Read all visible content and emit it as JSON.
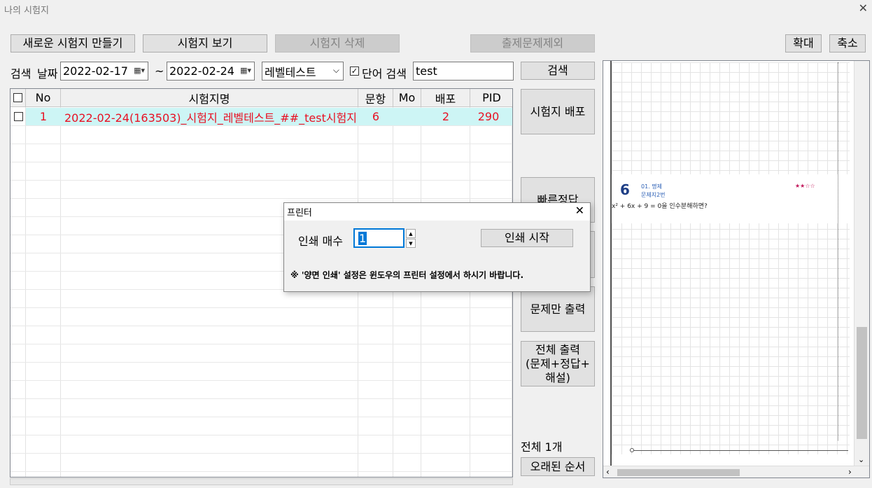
{
  "window": {
    "title": "나의 시험지"
  },
  "toolbar": {
    "new_label": "새로운 시험지 만들기",
    "view_label": "시험지 보기",
    "delete_label": "시험지 삭제",
    "exclude_label": "출제문제제외",
    "zoom_in_label": "확대",
    "zoom_out_label": "축소"
  },
  "search": {
    "search_label": "검색",
    "date_label": "날짜",
    "date_from": "2022-02-17",
    "tilde": "~",
    "date_to": "2022-02-24",
    "level_select": "레벨테스트",
    "word_search_label": "단어 검색",
    "word_search_checked": true,
    "query": "test",
    "search_button": "검색"
  },
  "table": {
    "headers": [
      "No",
      "시험지명",
      "문항",
      "Mo",
      "배포",
      "PID"
    ],
    "rows": [
      {
        "no": "1",
        "name": "2022-02-24(163503)_시험지_레벨테스트_##_test시험지",
        "count": "6",
        "mo": "",
        "deploy": "2",
        "pid": "290"
      }
    ]
  },
  "side": {
    "deploy_button": "시험지 배포",
    "quick_answer_button": "빠른정답",
    "problems_only_button": "문제만 출력",
    "print_all_line1": "전체 출력",
    "print_all_line2": "(문제+정답+",
    "print_all_line3": "해설)",
    "total_label": "전체 1개",
    "sort_button": "오래된 순서"
  },
  "preview": {
    "problem_number": "6",
    "category": "01. 명제",
    "sub": "문제지2번",
    "stars": "★★☆☆",
    "question": "x² + 6x + 9 = 0을 인수분해하면?"
  },
  "dialog": {
    "title": "프린터",
    "copies_label": "인쇄 매수",
    "copies_value": "1",
    "start_button": "인쇄 시작",
    "notice": "※ '양면 인쇄' 설정은 윈도우의 프린터 설정에서 하시기 바랍니다."
  },
  "colors": {
    "accent_row": "#cdf5f5",
    "row_text": "#e81123",
    "number": "#1f3f86"
  }
}
